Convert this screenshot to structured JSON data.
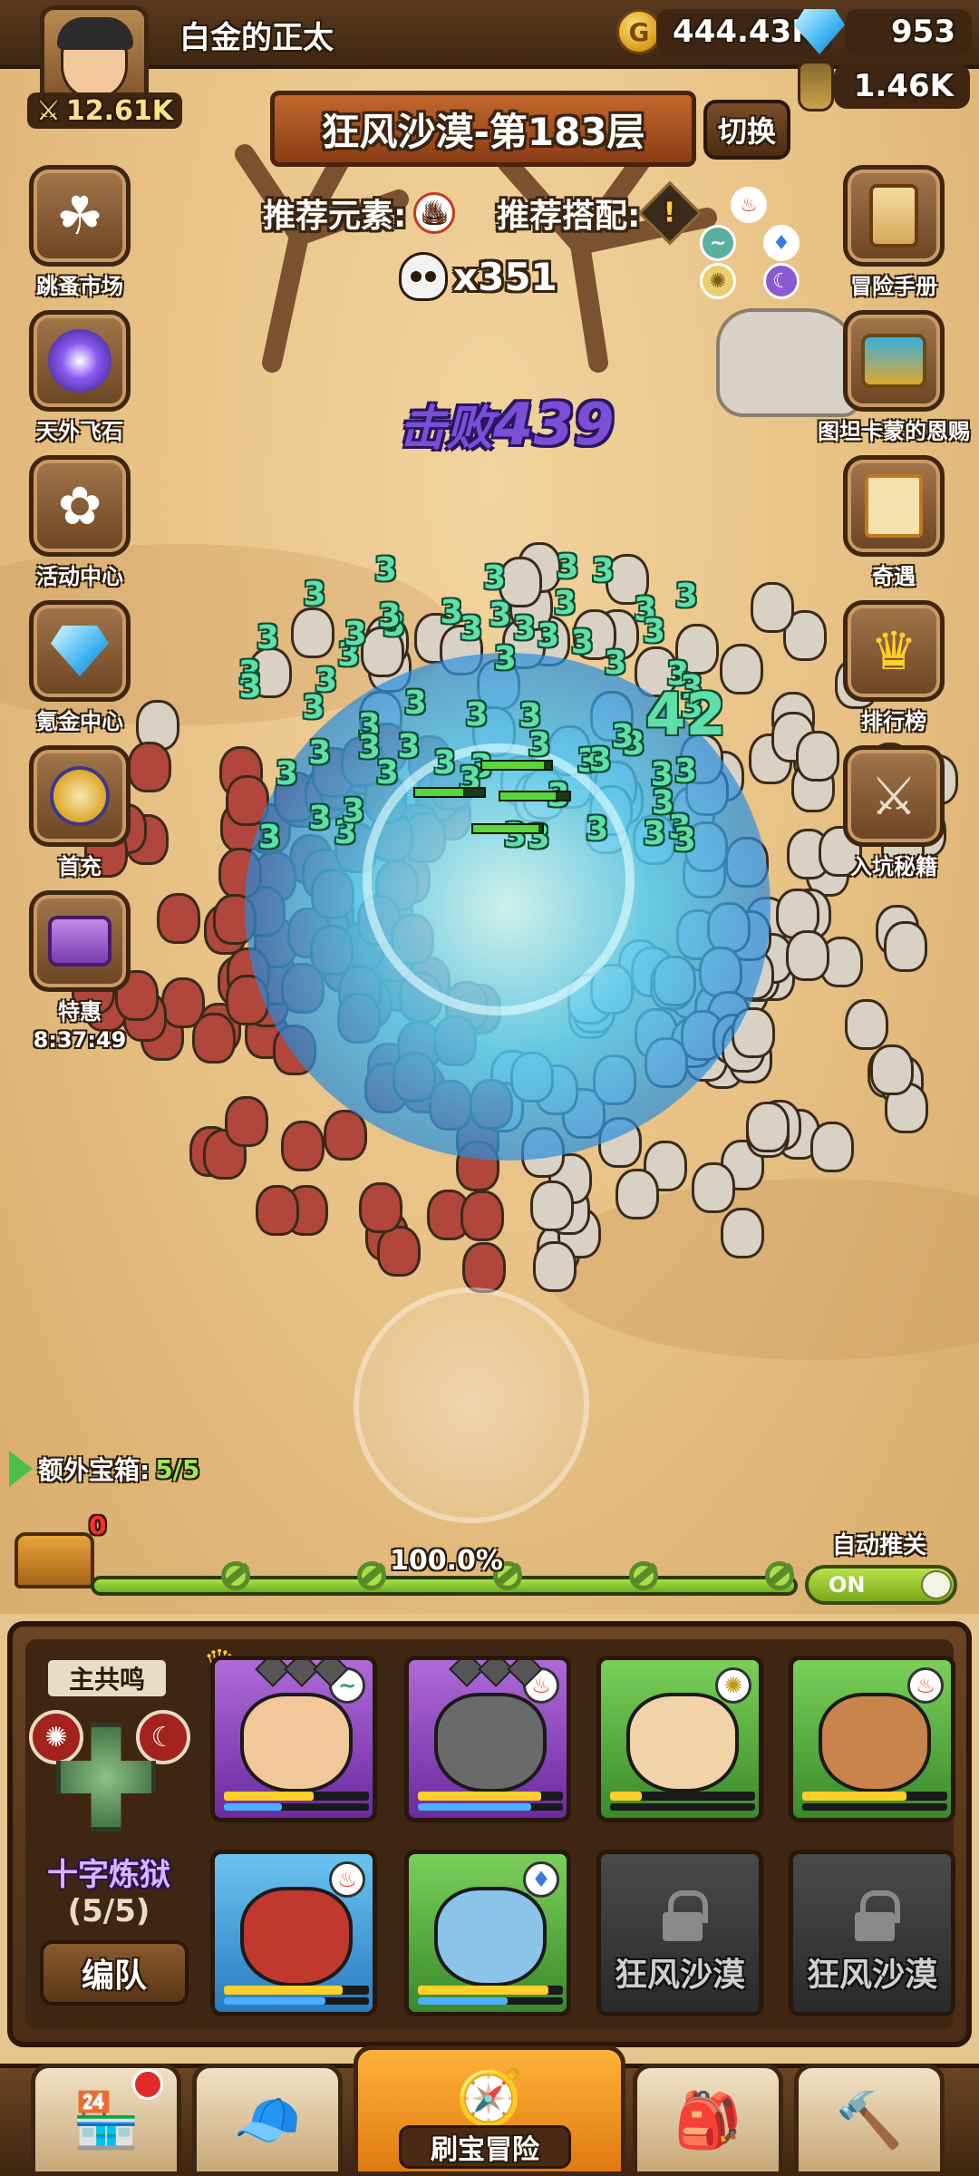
{
  "player": {
    "name": "白金的正太",
    "power": "12.61K",
    "power_icon": "crossed-swords-icon"
  },
  "currencies": {
    "gold": "444.43K",
    "gems": "953",
    "potion": "1.46K"
  },
  "level": {
    "title": "狂风沙漠-第183层",
    "switch_label": "切换"
  },
  "recommend": {
    "element_label": "推荐元素:",
    "combo_label": "推荐搭配:",
    "element_icon": "fire",
    "combo_icon": "warning"
  },
  "enemies": {
    "count": "x351",
    "defeat_label": "击败",
    "defeat_count": "439"
  },
  "damage_numbers": [
    "3",
    "3",
    "3",
    "3",
    "3",
    "3",
    "3",
    "3",
    "42"
  ],
  "left_menu": [
    {
      "label": "跳蚤市场",
      "icon": "clover-icon"
    },
    {
      "label": "天外飞石",
      "icon": "vortex-icon"
    },
    {
      "label": "活动中心",
      "icon": "bouquet-icon"
    },
    {
      "label": "氪金中心",
      "icon": "diamond-icon"
    },
    {
      "label": "首充",
      "icon": "gift-badge-icon"
    },
    {
      "label": "特惠",
      "icon": "treasure-chest-icon",
      "timer": "8:37:49"
    }
  ],
  "right_menu": [
    {
      "label": "冒险手册",
      "icon": "scroll-icon"
    },
    {
      "label": "图坦卡蒙的恩赐",
      "icon": "golden-chest-icon"
    },
    {
      "label": "奇遇",
      "icon": "notice-board-icon"
    },
    {
      "label": "排行榜",
      "icon": "crown-icon"
    },
    {
      "label": "入坑秘籍",
      "icon": "crossed-swords-icon"
    }
  ],
  "extra_chest": {
    "label": "额外宝箱:",
    "value": "5/5",
    "chest_count": "0"
  },
  "progress": {
    "label": "100.0%",
    "value": 1.0
  },
  "auto_push": {
    "label": "自动推关",
    "state": "ON"
  },
  "team": {
    "main_tag": "主共鸣",
    "formation_name": "十字炼狱",
    "formation_count": "(5/5)",
    "edit_label": "编队",
    "heroes": [
      {
        "rarity": "purple",
        "element": "wind",
        "hp": 0.62,
        "mp": 0.4,
        "skin": "#f2c79a"
      },
      {
        "rarity": "purple",
        "element": "fire",
        "hp": 0.85,
        "mp": 0.78,
        "skin": "#6a6a6a"
      },
      {
        "rarity": "green",
        "element": "light",
        "hp": 0.22,
        "mp": 0.0,
        "skin": "#f2d2a8"
      },
      {
        "rarity": "green",
        "element": "fire",
        "hp": 0.72,
        "mp": 0.0,
        "skin": "#c8844a"
      },
      {
        "rarity": "blue",
        "element": "fire",
        "hp": 0.82,
        "mp": 0.7,
        "skin": "#c0382e"
      },
      {
        "rarity": "green",
        "element": "water",
        "hp": 0.9,
        "mp": 0.62,
        "skin": "#8ac4e8"
      }
    ],
    "locked_label": "狂风沙漠"
  },
  "bottom_nav": {
    "active_label": "刷宝冒险",
    "items": [
      "shop-icon",
      "hero-icon",
      "adventure-map-icon",
      "backpack-icon",
      "forge-icon"
    ]
  },
  "colors": {
    "sand": "#e7c58f",
    "wood": "#3e2612",
    "defeat_purple": "#7a4fd6",
    "damage_green": "#5fe0a8",
    "accent_orange": "#e07a10"
  }
}
